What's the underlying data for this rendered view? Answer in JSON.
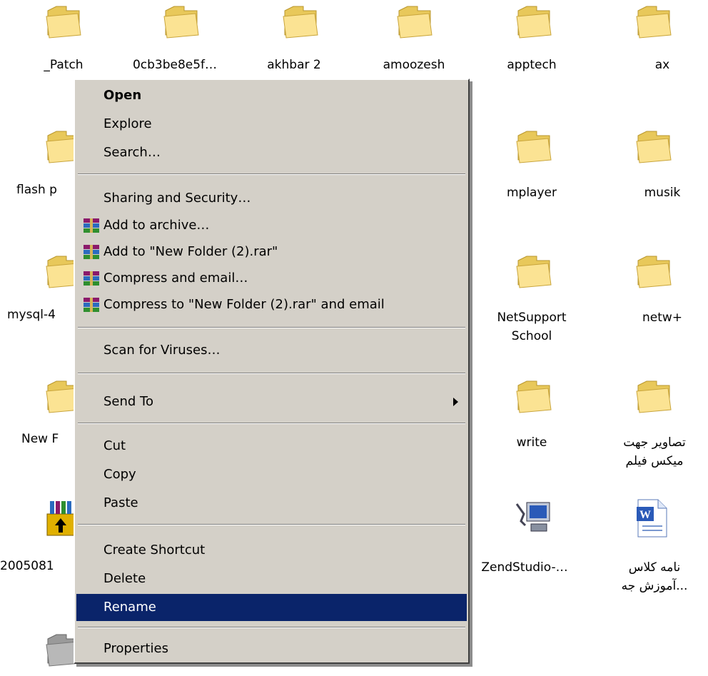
{
  "desktop": {
    "row1": [
      "_Patch",
      "0cb3be8e5f…",
      "akhbar 2",
      "amoozesh",
      "apptech",
      "ax"
    ],
    "row2_left": "flash p",
    "row2_right": [
      "mplayer",
      "musik"
    ],
    "row3_left": "mysql-4",
    "row3_right": [
      "NetSupport\nSchool",
      "netw+"
    ],
    "row4_left": "New F",
    "row4_right": [
      "write",
      "تصاویر جهت\nمیکس فیلم"
    ],
    "row5_left": "2005081",
    "row5_right": [
      "ZendStudio-…",
      "نامه کلاس\n...آموزش جه"
    ]
  },
  "context_menu": {
    "open": "Open",
    "explore": "Explore",
    "search": "Search…",
    "sharing": "Sharing and Security…",
    "add_archive": "Add to archive…",
    "add_rar": "Add to \"New Folder (2).rar\"",
    "compress_email": "Compress and email…",
    "compress_rar_email": "Compress to \"New Folder (2).rar\" and email",
    "scan": "Scan for Viruses…",
    "send_to": "Send To",
    "cut": "Cut",
    "copy": "Copy",
    "paste": "Paste",
    "create_shortcut": "Create Shortcut",
    "delete": "Delete",
    "rename": "Rename",
    "properties": "Properties"
  },
  "colors": {
    "menu_bg": "#d4d0c8",
    "highlight": "#0a246a",
    "folder": "#f3d77a"
  }
}
